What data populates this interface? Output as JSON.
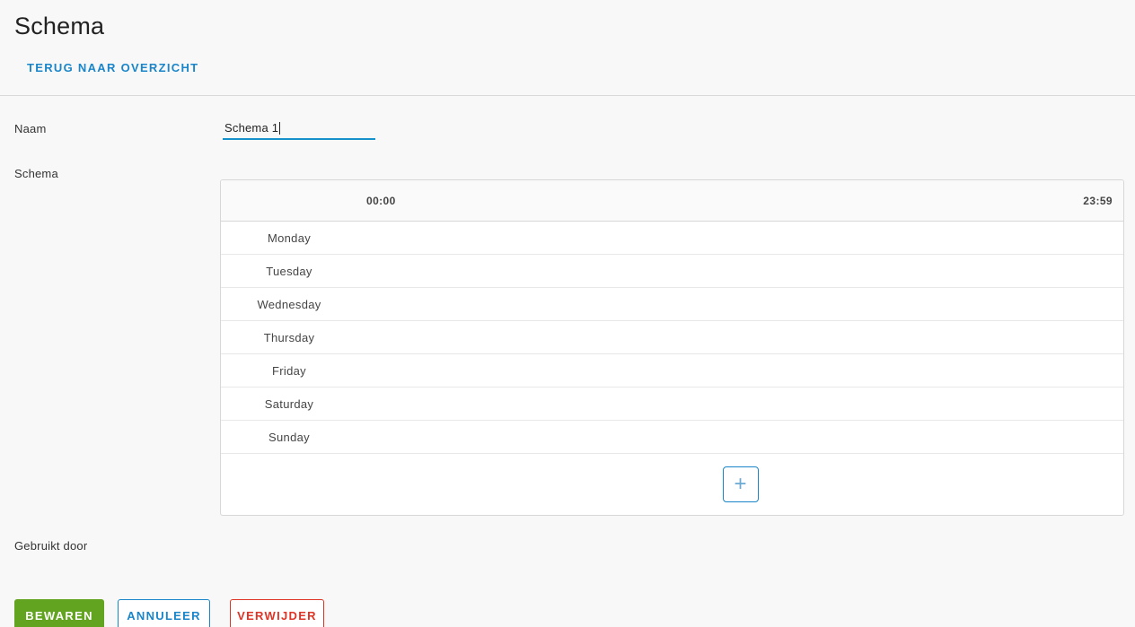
{
  "page": {
    "title": "Schema",
    "back_link_label": "TERUG NAAR OVERZICHT"
  },
  "form": {
    "name_label": "Naam",
    "name_value": "Schema 1",
    "schema_label": "Schema",
    "used_by_label": "Gebruikt door"
  },
  "schedule": {
    "start_time": "00:00",
    "end_time": "23:59",
    "days": [
      "Monday",
      "Tuesday",
      "Wednesday",
      "Thursday",
      "Friday",
      "Saturday",
      "Sunday"
    ],
    "add_button_glyph": "+"
  },
  "actions": {
    "save_label": "BEWAREN",
    "cancel_label": "ANNULEER",
    "delete_label": "VERWIJDER"
  },
  "colors": {
    "accent_blue": "#1a85c8",
    "input_underline_blue": "#1791c9",
    "save_green": "#62a420",
    "delete_red": "#de3426",
    "page_background": "#f8f8f8",
    "panel_border": "#d7d7d7"
  }
}
